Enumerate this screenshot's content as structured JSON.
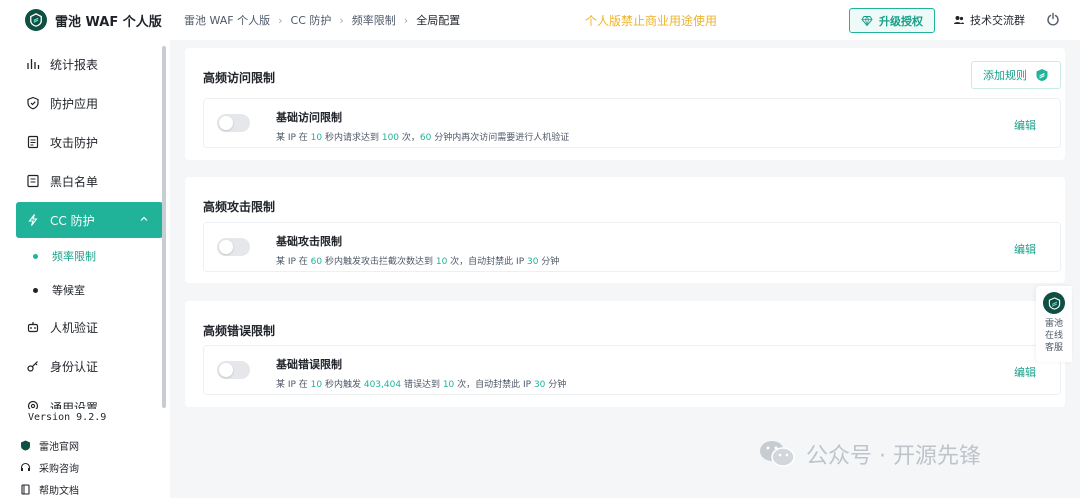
{
  "brand": {
    "name": "雷池 WAF 个人版"
  },
  "breadcrumb": [
    "雷池 WAF 个人版",
    "CC 防护",
    "频率限制",
    "全局配置"
  ],
  "notice": "个人版禁止商业用途使用",
  "header": {
    "upgrade": "升级授权",
    "community": "技术交流群"
  },
  "sidebar": {
    "items": [
      {
        "label": "统计报表",
        "icon": "bar-chart-icon"
      },
      {
        "label": "防护应用",
        "icon": "shield-icon"
      },
      {
        "label": "攻击防护",
        "icon": "document-icon"
      },
      {
        "label": "黑白名单",
        "icon": "list-icon"
      },
      {
        "label": "CC 防护",
        "icon": "lightning-icon",
        "active": true
      },
      {
        "label": "人机验证",
        "icon": "robot-icon"
      },
      {
        "label": "身份认证",
        "icon": "key-icon"
      },
      {
        "label": "通用设置",
        "icon": "gear-icon"
      }
    ],
    "subitems": [
      {
        "label": "频率限制",
        "active": true
      },
      {
        "label": "等候室"
      }
    ],
    "version": "Version 9.2.9",
    "footer": [
      {
        "label": "雷池官网",
        "icon": "logo-icon"
      },
      {
        "label": "采购咨询",
        "icon": "headset-icon"
      },
      {
        "label": "帮助文档",
        "icon": "book-icon"
      }
    ]
  },
  "sections": [
    {
      "title": "高频访问限制",
      "add_rule": "添加规则",
      "rule": {
        "name": "基础访问限制",
        "desc": {
          "a": "某 IP 在 ",
          "n1": "10",
          "b": " 秒内请求达到 ",
          "n2": "100",
          "c": " 次，",
          "n3": "60",
          "d": " 分钟内再次访问需要进行人机验证"
        },
        "edit": "编辑",
        "enabled": false
      }
    },
    {
      "title": "高频攻击限制",
      "rule": {
        "name": "基础攻击限制",
        "desc": {
          "a": "某 IP 在 ",
          "n1": "60",
          "b": " 秒内触发攻击拦截次数达到 ",
          "n2": "10",
          "c": " 次，自动封禁此 IP ",
          "n3": "30",
          "d": " 分钟"
        },
        "edit": "编辑",
        "enabled": false
      }
    },
    {
      "title": "高频错误限制",
      "rule": {
        "name": "基础错误限制",
        "desc": {
          "a": "某 IP 在 ",
          "n1": "10",
          "b": " 秒内触发 ",
          "n2": "403,404",
          "c": " 错误达到 ",
          "n3": "10",
          "d": " 次，自动封禁此 IP ",
          "n4": "30",
          "e": " 分钟"
        },
        "edit": "编辑",
        "enabled": false
      }
    }
  ],
  "float_service": [
    "雷池",
    "在线",
    "客服"
  ],
  "watermark": "公众号 · 开源先锋",
  "colors": {
    "accent": "#20b39a",
    "notice": "#f0b32b",
    "brand_dark": "#0f4f44"
  }
}
